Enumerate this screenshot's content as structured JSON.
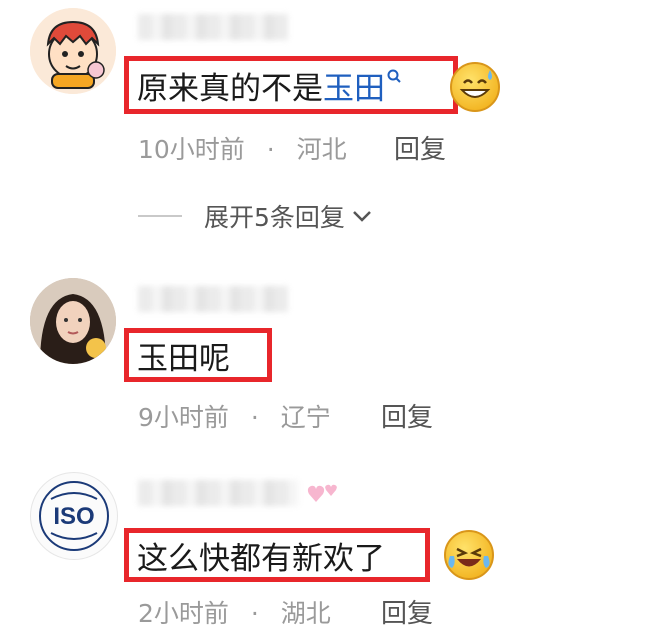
{
  "comments": [
    {
      "text_plain": "原来真的不是",
      "text_link": "玉田",
      "time": "10小时前",
      "location": "河北",
      "reply": "回复",
      "expand": "展开5条回复"
    },
    {
      "text_plain": "玉田呢",
      "time": "9小时前",
      "location": "辽宁",
      "reply": "回复"
    },
    {
      "text_plain": "这么快都有新欢了",
      "time": "2小时前",
      "location": "湖北",
      "reply": "回复",
      "avatar_logo": "ISO"
    }
  ],
  "separator": "·",
  "colors": {
    "highlight_border": "#e8262b",
    "link": "#1f5fbf",
    "meta": "#9a9a9a"
  },
  "icons": [
    "search-icon",
    "chevron-down-icon",
    "sweat-smile-emoji-icon",
    "laughing-tears-emoji-icon",
    "pink-hearts-icon"
  ]
}
